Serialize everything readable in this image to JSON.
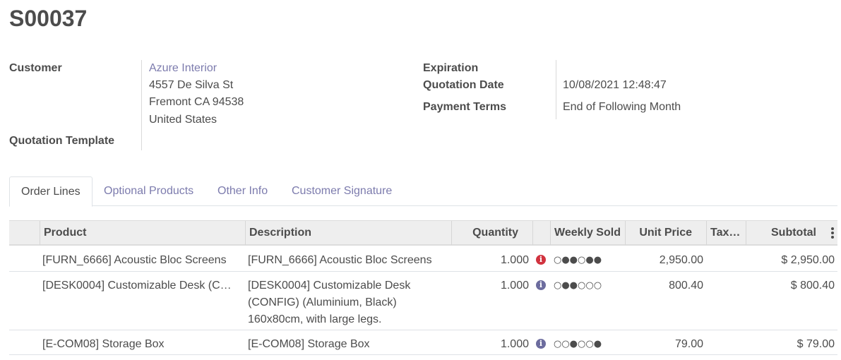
{
  "record": {
    "name": "S00037"
  },
  "form": {
    "customer_label": "Customer",
    "customer_name": "Azure Interior",
    "address_line1": "4557 De Silva St",
    "address_line2": "Fremont CA 94538",
    "address_line3": "United States",
    "quotation_template_label": "Quotation Template",
    "expiration_label": "Expiration",
    "quotation_date_label": "Quotation Date",
    "quotation_date_value": "10/08/2021 12:48:47",
    "payment_terms_label": "Payment Terms",
    "payment_terms_value": "End of Following Month"
  },
  "tabs": [
    {
      "label": "Order Lines",
      "active": true
    },
    {
      "label": "Optional Products"
    },
    {
      "label": "Other Info"
    },
    {
      "label": "Customer Signature"
    }
  ],
  "table": {
    "headers": {
      "product": "Product",
      "description": "Description",
      "quantity": "Quantity",
      "weekly_sold": "Weekly Sold",
      "unit_price": "Unit Price",
      "taxes": "Tax…",
      "subtotal": "Subtotal"
    },
    "rows": [
      {
        "product": "[FURN_6666] Acoustic Bloc Screens",
        "description": "[FURN_6666] Acoustic Bloc Screens",
        "quantity": "1.000",
        "info_color": "#d1333f",
        "weekly_sold": "○●●○●●",
        "unit_price": "2,950.00",
        "subtotal": "$ 2,950.00"
      },
      {
        "product": "[DESK0004] Customizable Desk (C…",
        "description": "[DESK0004] Customizable Desk (CONFIG) (Aluminium, Black) 160x80cm, with large legs.",
        "quantity": "1.000",
        "info_color": "#6c6c9e",
        "weekly_sold": "○●●○○○",
        "unit_price": "800.40",
        "subtotal": "$ 800.40"
      },
      {
        "product": "[E-COM08] Storage Box",
        "description": "[E-COM08] Storage Box",
        "quantity": "1.000",
        "info_color": "#6c6c9e",
        "weekly_sold": "○○●○○●",
        "unit_price": "79.00",
        "subtotal": "$ 79.00"
      }
    ]
  },
  "icons": {
    "info_icon_glyph": "i"
  }
}
